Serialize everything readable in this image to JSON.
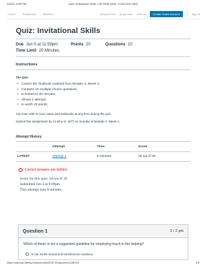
{
  "print_header": {
    "date": "4/4/22, 8:59 PM",
    "page_title": "Quiz: Invitational Skills: CEF2305 (362), COUC305 (362)"
  },
  "nav": {
    "left_links": [
      "Online",
      "Residential",
      "Athletics"
    ],
    "right_links": [
      "Request Info",
      "Apply Now",
      "Visit Us"
    ],
    "create_account": "Create Guest Account",
    "sign_in": "Sign In"
  },
  "quiz": {
    "title": "Quiz: Invitational Skills",
    "due_label": "Due",
    "due_value": "Jun 5 at 11:59pm",
    "points_label": "Points",
    "points_value": "20",
    "questions_label": "Questions",
    "questions_value": "10",
    "time_limit_label": "Time Limit",
    "time_limit_value": "20 Minutes"
  },
  "instructions": {
    "heading": "Instructions",
    "quiz_heading": "The quiz:",
    "bullets": [
      "Covers the Textbook material from Module 4: Week 4.",
      "Contains 10 multiple-choice questions.",
      "Is limited to 20 minutes.",
      "Allows 1 attempt.",
      "Is worth 20 points."
    ],
    "para1": "You may refer to your notes and textbooks at any time during the quiz.",
    "para2": "Submit this assignment by 11:59 p.m. (ET) on Sunday of Module 4: Week 4."
  },
  "attempt_history": {
    "heading": "Attempt History",
    "columns": [
      "",
      "Attempt",
      "Time",
      "Score"
    ],
    "rows": [
      {
        "label": "LATEST",
        "attempt": "Attempt 1",
        "time": "8 minutes",
        "score": "18 out of 20"
      }
    ]
  },
  "results": {
    "hidden_notice": "Correct answers are hidden.",
    "score_line": "Score for this quiz: 18 out of 20",
    "submitted_line": "Submitted Jun 4 at 9:09pm",
    "took_line": "This attempt took 8 minutes."
  },
  "question": {
    "title": "Question 1",
    "points": "2 / 2 pts",
    "text": "Which of these is not a suggested guideline for employing touch in the helping?",
    "option_1": "It can evoke sexual and transference reactions"
  },
  "print_footer": {
    "url": "https://canvas.liberty.edu/courses/203719/quizzes/1446700",
    "page": "1/6"
  }
}
